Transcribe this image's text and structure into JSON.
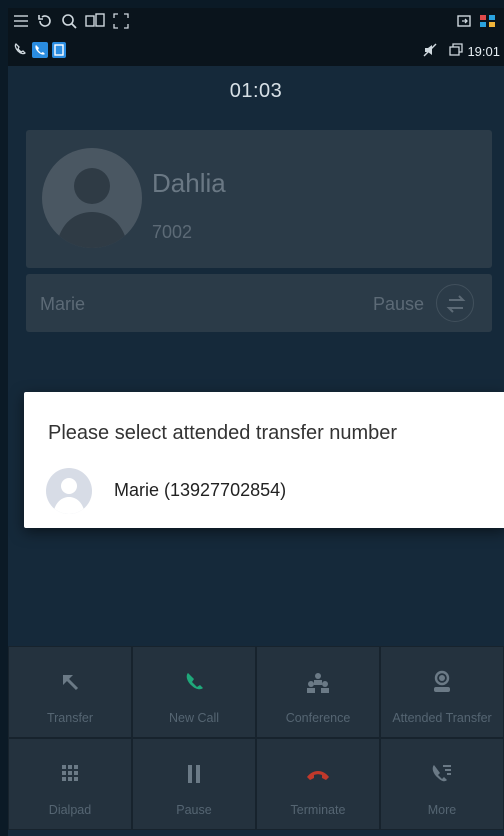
{
  "status": {
    "clock": "19:01"
  },
  "call": {
    "timer": "01:03",
    "caller_name": "Dahlia",
    "caller_number": "7002"
  },
  "held_call": {
    "name": "Marie",
    "status": "Pause"
  },
  "dialog": {
    "title": "Please select attended transfer number",
    "items": [
      {
        "label": "Marie (13927702854)"
      }
    ]
  },
  "actions": [
    {
      "label": "Transfer",
      "icon": "transfer-arrow-icon"
    },
    {
      "label": "New Call",
      "icon": "phone-icon"
    },
    {
      "label": "Conference",
      "icon": "conference-icon"
    },
    {
      "label": "Attended Transfer",
      "icon": "attended-transfer-icon"
    },
    {
      "label": "Dialpad",
      "icon": "dialpad-icon"
    },
    {
      "label": "Pause",
      "icon": "pause-icon"
    },
    {
      "label": "Terminate",
      "icon": "hangup-icon"
    },
    {
      "label": "More",
      "icon": "more-phone-icon"
    }
  ],
  "colors": {
    "accent_green": "#1fa87a",
    "terminate_red": "#c0392b",
    "dialog_bg": "#ffffff"
  }
}
